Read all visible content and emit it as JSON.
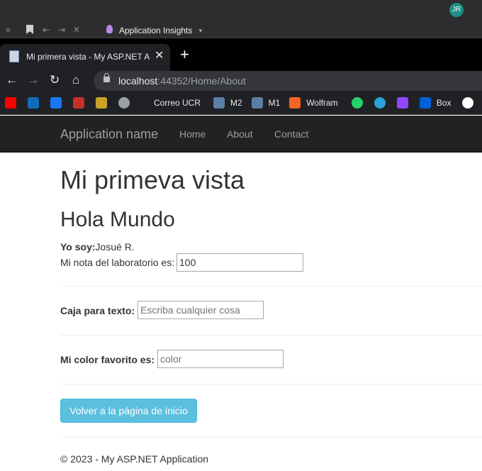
{
  "ide": {
    "user_initials": "JR",
    "toolbar_label": "Application Insights"
  },
  "browser": {
    "tab_title": "Mi primera vista - My ASP.NET Application",
    "url_host": "localhost",
    "url_rest": ":44352/Home/About",
    "bookmarks": [
      {
        "label": "",
        "icon": "youtube-icon",
        "color": "#ff0000"
      },
      {
        "label": "",
        "icon": "outlook-icon",
        "color": "#0f6cbd"
      },
      {
        "label": "",
        "icon": "facebook-icon",
        "color": "#1877f2"
      },
      {
        "label": "",
        "icon": "hd-icon",
        "color": "#c4302b"
      },
      {
        "label": "",
        "icon": "movie-icon",
        "color": "#c9a227"
      },
      {
        "label": "",
        "icon": "edge-icon",
        "color": "#9aa0a6"
      },
      {
        "label": "Correo UCR",
        "icon": "",
        "color": ""
      },
      {
        "label": "M2",
        "icon": "moodle-icon",
        "color": "#5b7ea6"
      },
      {
        "label": "M1",
        "icon": "moodle-icon",
        "color": "#5b7ea6"
      },
      {
        "label": "Wolfram",
        "icon": "wolfram-icon",
        "color": "#f26522"
      },
      {
        "label": "",
        "icon": "whatsapp-icon",
        "color": "#25d366"
      },
      {
        "label": "",
        "icon": "telegram-icon",
        "color": "#2aa1da"
      },
      {
        "label": "",
        "icon": "twitch-icon",
        "color": "#9146ff"
      },
      {
        "label": "Box",
        "icon": "box-icon",
        "color": "#0061d5"
      },
      {
        "label": "",
        "icon": "github-icon",
        "color": "#ffffff"
      }
    ]
  },
  "site": {
    "brand": "Application name",
    "nav": [
      "Home",
      "About",
      "Contact"
    ]
  },
  "page": {
    "h1": "Mi primeva vista",
    "h2": "Hola Mundo",
    "yo_soy_label": "Yo soy:",
    "yo_soy_value": "Josué R.",
    "nota_label": "Mi nota del laboratorio es:",
    "nota_value": "100",
    "caja_label": "Caja para texto:",
    "caja_placeholder": "Escriba cualquier cosa",
    "color_label": "Mi color favorito es:",
    "color_placeholder": "color",
    "button_label": "Volver a la página de inicio",
    "footer": "© 2023 - My ASP.NET Application"
  }
}
